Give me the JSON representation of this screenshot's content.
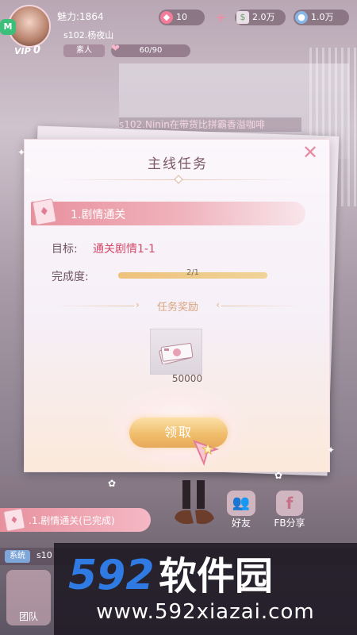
{
  "player": {
    "charm": "魅力:1864",
    "server_name": "s102.杨夜山",
    "vip_label": "VIP",
    "vip_level": "0",
    "rank_tag": "素人",
    "exp": "60/90",
    "m_badge": "M"
  },
  "currencies": [
    {
      "icon": "diamond-icon",
      "value": "10"
    },
    {
      "icon": "cash-icon",
      "value": "2.0万"
    },
    {
      "icon": "coin-icon",
      "value": "1.0万"
    }
  ],
  "ticker": "s102.Ninin在带货比拼霸香溢咖啡",
  "modal": {
    "title": "主线任务",
    "close_icon": "close-icon",
    "task_name": "1.剧情通关",
    "goal_label": "目标:",
    "goal_value": "通关剧情1-1",
    "progress_label": "完成度:",
    "progress_text": "2/1",
    "progress_fraction": 1.0,
    "reward_title": "任务奖励",
    "reward_amount": "50000",
    "claim_label": "领取"
  },
  "bottom": {
    "completed_task": ".1.剧情通关(已完成)",
    "friend_label": "好友",
    "fb_label": "FB分享",
    "fb_glyph": "f",
    "chat_tag": "系统",
    "chat_text": "s10",
    "team_label": "团队"
  },
  "watermark": {
    "logo": "592软件园",
    "url": "www.592xiazai.com"
  },
  "colors": {
    "accent_pink": "#e8909e",
    "gold": "#f0be6c",
    "goal_red": "#d44a6a"
  }
}
